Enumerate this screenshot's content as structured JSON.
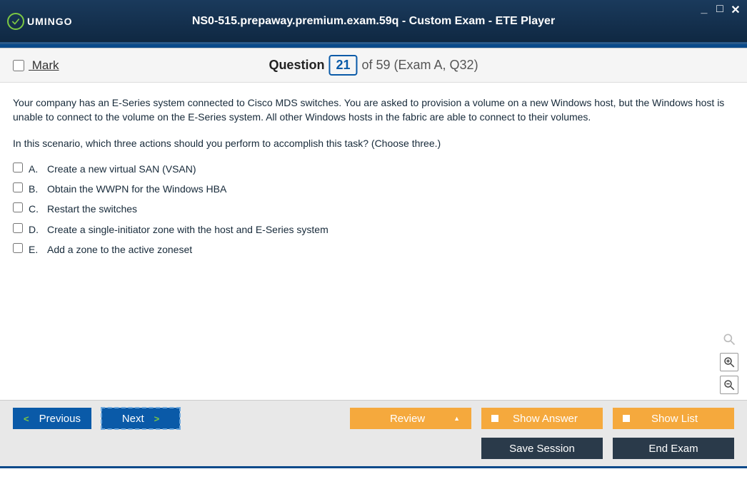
{
  "window": {
    "title": "NS0-515.prepaway.premium.exam.59q - Custom Exam - ETE Player",
    "logo_text": "UMINGO"
  },
  "header": {
    "mark_label": "Mark",
    "question_word": "Question",
    "question_num": "21",
    "question_suffix": "of 59 (Exam A, Q32)"
  },
  "question": {
    "para1": "Your company has an E-Series system connected to Cisco MDS switches. You are asked to provision a volume on a new Windows host, but the Windows host is unable to connect to the volume on the E-Series system. All other Windows hosts in the fabric are able to connect to their volumes.",
    "para2": "In this scenario, which three actions should you perform to accomplish this task? (Choose three.)"
  },
  "options": [
    {
      "letter": "A.",
      "text": "Create a new virtual SAN (VSAN)"
    },
    {
      "letter": "B.",
      "text": "Obtain the WWPN for the Windows HBA"
    },
    {
      "letter": "C.",
      "text": "Restart the switches"
    },
    {
      "letter": "D.",
      "text": "Create a single-initiator zone with the host and E-Series system"
    },
    {
      "letter": "E.",
      "text": "Add a zone to the active zoneset"
    }
  ],
  "footer": {
    "previous": "Previous",
    "next": "Next",
    "review": "Review",
    "show_answer": "Show Answer",
    "show_list": "Show List",
    "save_session": "Save Session",
    "end_exam": "End Exam"
  }
}
